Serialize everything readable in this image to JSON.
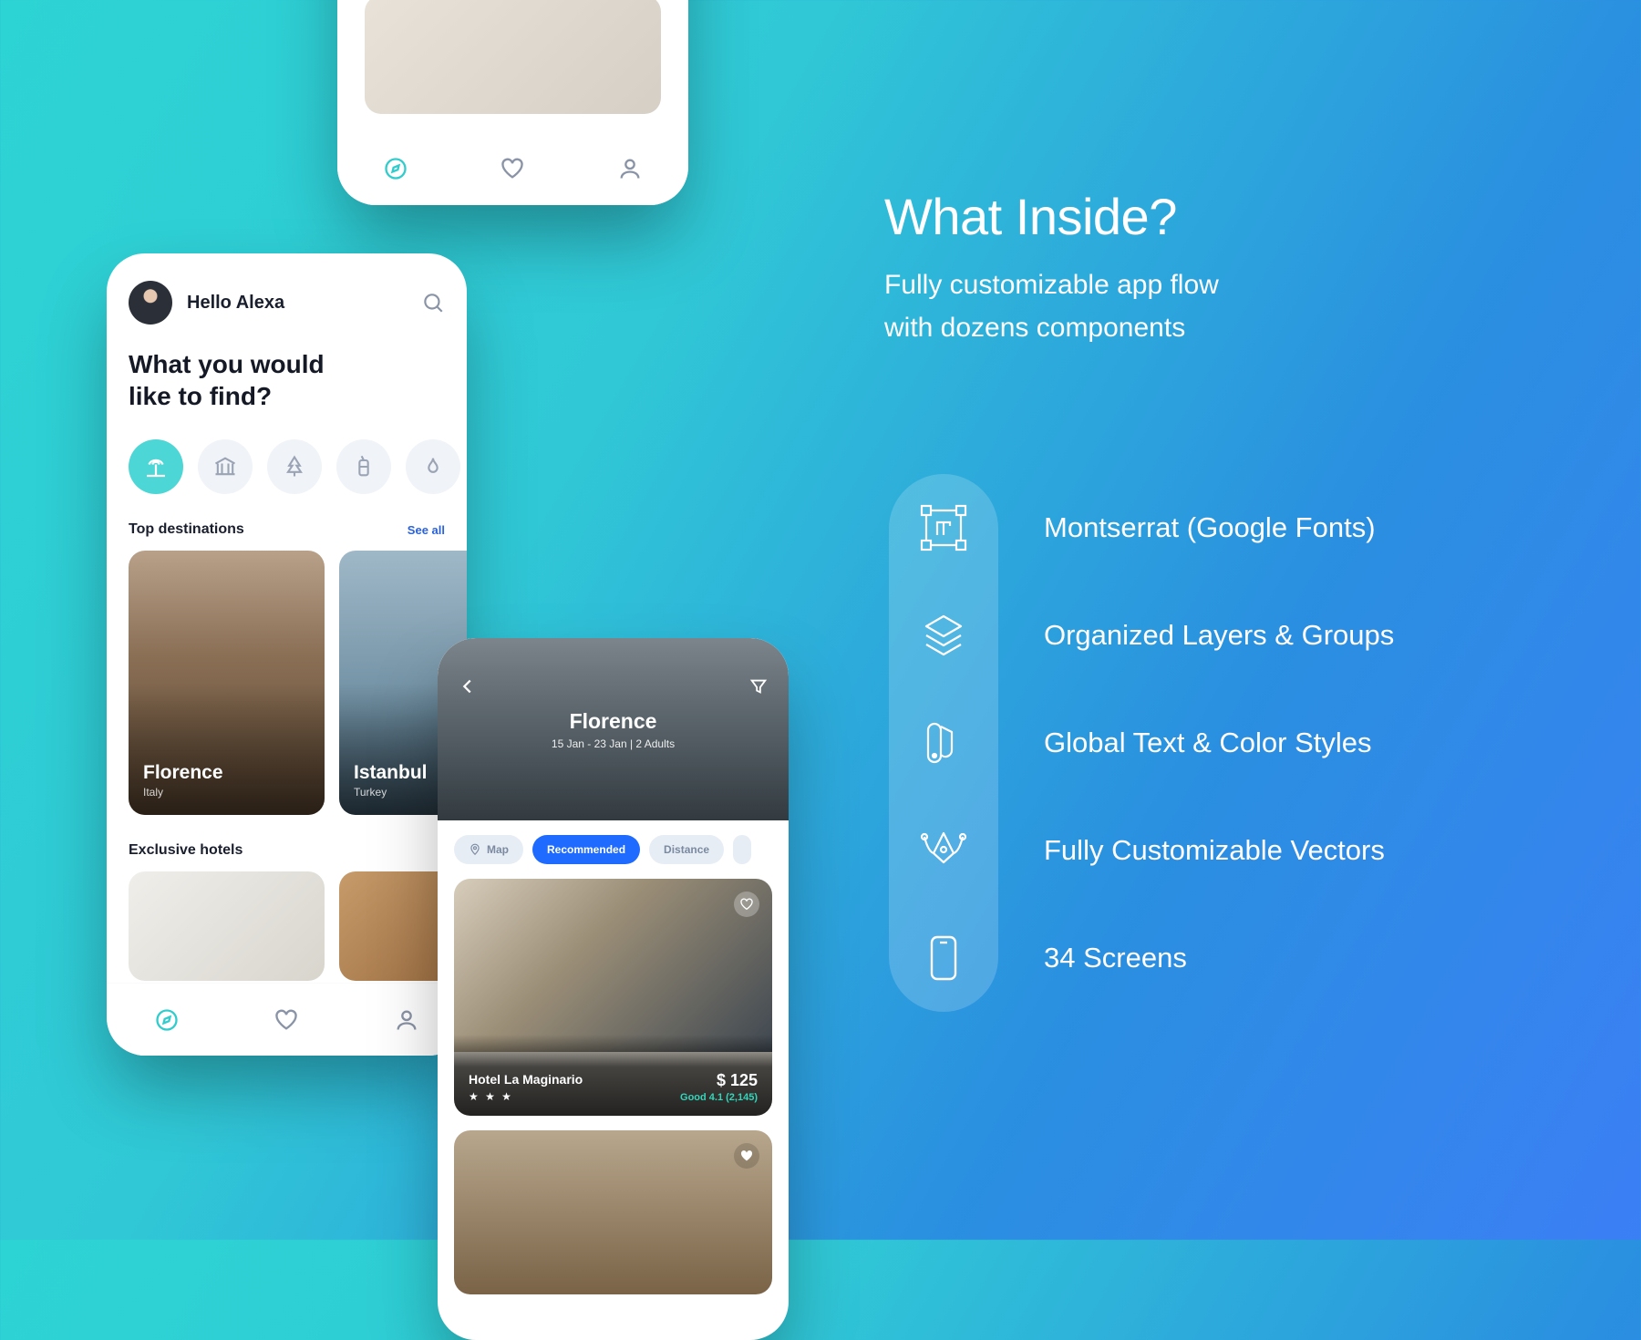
{
  "promo": {
    "title": "What Inside?",
    "subtitle_l1": "Fully customizable app flow",
    "subtitle_l2": "with dozens components",
    "features": [
      "Montserrat (Google Fonts)",
      "Organized Layers & Groups",
      "Global Text & Color Styles",
      "Fully Customizable Vectors",
      "34 Screens"
    ]
  },
  "phone_main": {
    "greeting": "Hello Alexa",
    "headline_l1": "What you would",
    "headline_l2": "like to find?",
    "sections": {
      "top_title": "Top destinations",
      "see_all": "See all",
      "exclusive_title": "Exclusive hotels"
    },
    "destinations": [
      {
        "name": "Florence",
        "country": "Italy"
      },
      {
        "name": "Istanbul",
        "country": "Turkey"
      }
    ]
  },
  "phone_detail": {
    "hero_title": "Florence",
    "hero_sub": "15 Jan - 23 Jan | 2 Adults",
    "chips": {
      "map": "Map",
      "recommended": "Recommended",
      "distance": "Distance"
    },
    "hotel": {
      "name": "Hotel La Maginario",
      "stars": "★ ★ ★",
      "price": "$ 125",
      "rating": "Good 4.1 (2,145)"
    }
  }
}
